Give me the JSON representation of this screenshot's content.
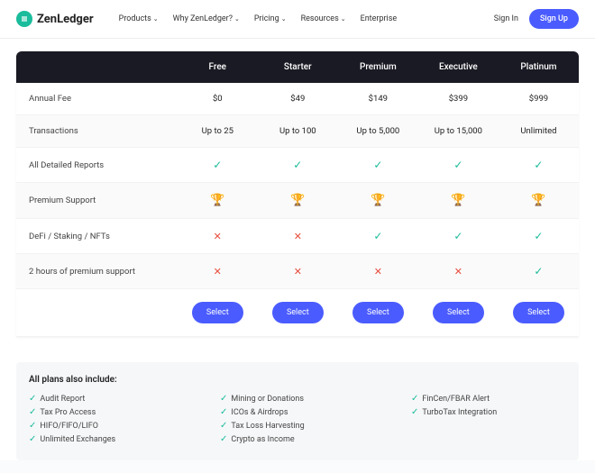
{
  "brand": "ZenLedger",
  "nav": {
    "items": [
      "Products",
      "Why ZenLedger?",
      "Pricing",
      "Resources",
      "Enterprise"
    ],
    "signin": "Sign In",
    "signup": "Sign Up"
  },
  "pricing": {
    "plans": [
      "Free",
      "Starter",
      "Premium",
      "Executive",
      "Platinum"
    ],
    "rows": [
      {
        "label": "Annual Fee",
        "type": "text",
        "values": [
          "$0",
          "$49",
          "$149",
          "$399",
          "$999"
        ]
      },
      {
        "label": "Transactions",
        "type": "text",
        "values": [
          "Up to 25",
          "Up to 100",
          "Up to 5,000",
          "Up to 15,000",
          "Unlimited"
        ]
      },
      {
        "label": "All Detailed Reports",
        "type": "check",
        "values": [
          true,
          true,
          true,
          true,
          true
        ]
      },
      {
        "label": "Premium Support",
        "type": "trophy",
        "values": [
          true,
          true,
          true,
          true,
          true
        ]
      },
      {
        "label": "DeFi / Staking / NFTs",
        "type": "check",
        "values": [
          false,
          false,
          true,
          true,
          true
        ]
      },
      {
        "label": "2 hours of premium support",
        "type": "check",
        "values": [
          false,
          false,
          false,
          false,
          true
        ]
      }
    ],
    "select_label": "Select"
  },
  "includes": {
    "title": "All plans also include:",
    "cols": [
      [
        "Audit Report",
        "Tax Pro Access",
        "HIFO/FIFO/LIFO",
        "Unlimited Exchanges"
      ],
      [
        "Mining or Donations",
        "ICOs & Airdrops",
        "Tax Loss Harvesting",
        "Crypto as Income"
      ],
      [
        "FinCen/FBAR Alert",
        "TurboTax Integration"
      ]
    ]
  }
}
